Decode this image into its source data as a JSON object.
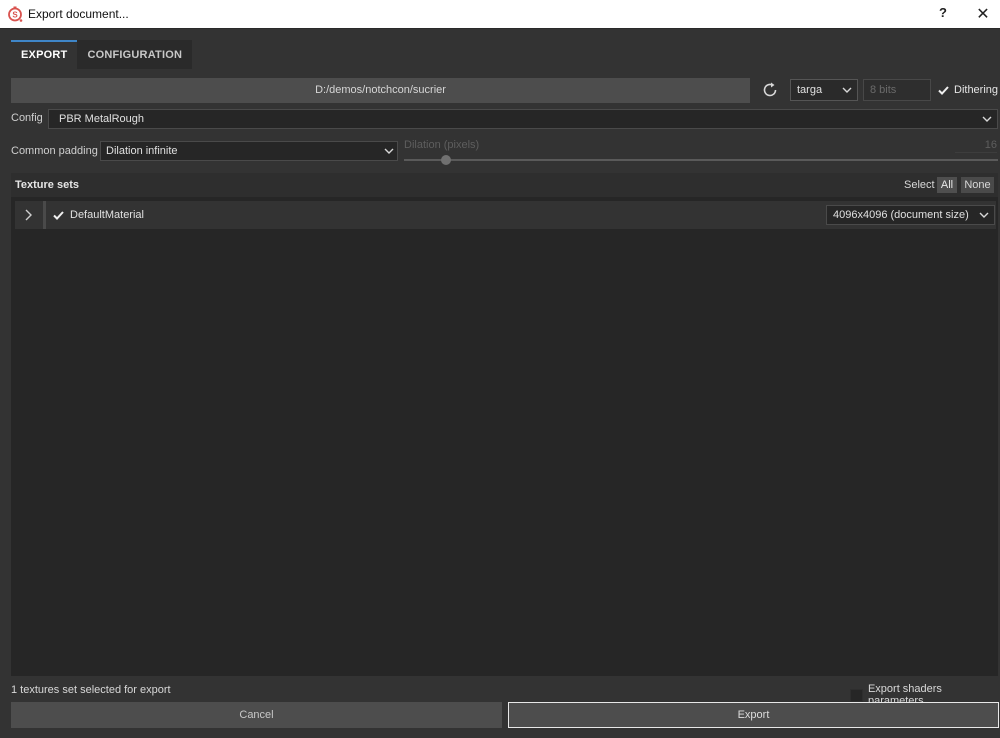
{
  "window": {
    "title": "Export document...",
    "help_label": "?",
    "close_label": "✕",
    "app_icon": "substance-painter-icon"
  },
  "tabs": [
    {
      "label": "EXPORT",
      "active": true
    },
    {
      "label": "CONFIGURATION",
      "active": false
    }
  ],
  "export": {
    "output_path": "D:/demos/notchcon/sucrier",
    "refresh_icon": "refresh-icon",
    "file_format": "targa",
    "bit_depth_placeholder": "8 bits",
    "dithering_label": "Dithering",
    "dithering_checked": true,
    "config_label": "Config",
    "config_value": "PBR MetalRough",
    "padding_label": "Common padding",
    "padding_value": "Dilation infinite",
    "dilation_label": "Dilation (pixels)",
    "dilation_value": "16",
    "dilation_slider_fraction": 0.07
  },
  "texture_sets": {
    "title": "Texture sets",
    "select_label": "Select",
    "all_label": "All",
    "none_label": "None",
    "items": [
      {
        "name": "DefaultMaterial",
        "checked": true,
        "size": "4096x4096 (document size)",
        "expanded": false
      }
    ]
  },
  "footer": {
    "status": "1 textures set selected for export",
    "export_shaders_label": "Export shaders parameters",
    "export_shaders_checked": false,
    "cancel_label": "Cancel",
    "export_label": "Export"
  },
  "colors": {
    "accent": "#3f86c8",
    "background": "#333333",
    "panel": "#262626",
    "app_icon": "#d9534f"
  }
}
